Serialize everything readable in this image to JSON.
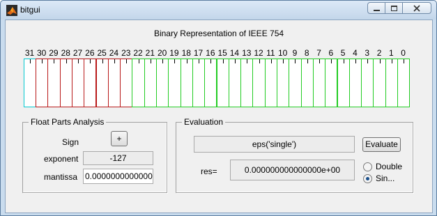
{
  "window": {
    "title": "bitgui",
    "minimize_icon": "minimize-icon",
    "maximize_icon": "maximize-icon",
    "close_icon": "close-icon"
  },
  "header": {
    "title": "Binary Representation of IEEE 754"
  },
  "bits": {
    "labels": [
      "31",
      "30",
      "29",
      "28",
      "27",
      "26",
      "25",
      "24",
      "23",
      "22",
      "21",
      "20",
      "19",
      "18",
      "17",
      "16",
      "15",
      "14",
      "13",
      "12",
      "11",
      "10",
      "9",
      "8",
      "7",
      "6",
      "5",
      "4",
      "3",
      "2",
      "1",
      "0"
    ],
    "colors": {
      "sign": "#00c8d0",
      "exponent": "#b81818",
      "mantissa": "#22cc22"
    }
  },
  "float_parts": {
    "title": "Float Parts Analysis",
    "sign_label": "Sign",
    "sign_button": "+",
    "exponent_label": "exponent",
    "exponent_value": "-127",
    "mantissa_label": "mantissa",
    "mantissa_value": "0.0000000000000"
  },
  "evaluation": {
    "title": "Evaluation",
    "expression": "eps('single')",
    "evaluate_button": "Evaluate",
    "res_label": "res=",
    "res_value": "0.000000000000000e+00",
    "radio_double": "Double",
    "radio_single": "Sin...",
    "selected": "single"
  }
}
